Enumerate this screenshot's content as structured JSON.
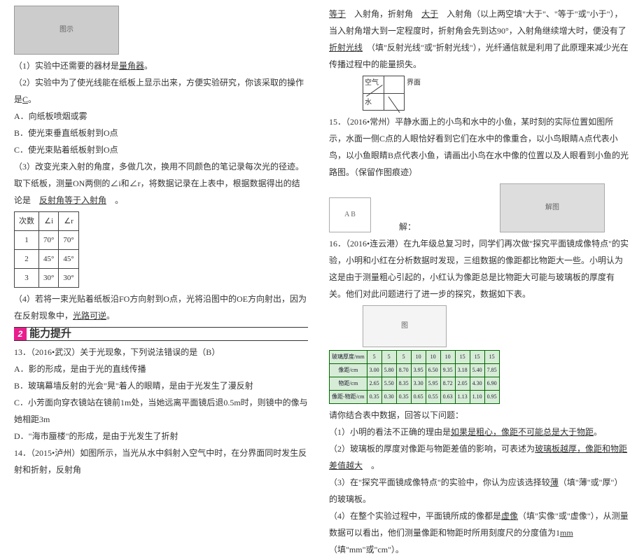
{
  "left": {
    "fig_label": "图示",
    "q1": "（1）实验中还需要的器材是",
    "a1": "量角器",
    "period": "。",
    "q2": "（2）实验中为了使光线能在纸板上显示出来，方便实验研究，你该采取的操作是",
    "a2": "C",
    "optA": "A．向纸板喷烟或雾",
    "optB": "B．使光束垂直纸板射到O点",
    "optC": "C．使光束贴着纸板射到O点",
    "q3a": "（3）改变光束入射的角度，多做几次，换用不同颜色的笔记录每次光的径迹。取下纸板，测量ON两侧的∠i和∠r，将数据记录在上表中，根据数据得出的结论是",
    "a3": "反射角等于入射角",
    "t1": {
      "h_n": "次数",
      "h_i": "∠i",
      "h_r": "∠r",
      "r1": [
        "1",
        "70°",
        "70°"
      ],
      "r2": [
        "2",
        "45°",
        "45°"
      ],
      "r3": [
        "3",
        "30°",
        "30°"
      ]
    },
    "q4a": "（4）若将一束光贴着纸板沿FO方向射到O点，光将沿图中的OE方向射出，因为在反射现象中，",
    "a4": "光路可逆",
    "ability_num": "2",
    "ability_text": "能力提升",
    "q13": "13．（2016•武汉）关于光现象，下列说法错误的是（B）",
    "q13A": "A．影的形成，是由于光的直线传播",
    "q13B": "B．玻璃幕墙反射的光会\"晃\"着人的眼睛，是由于光发生了漫反射",
    "q13C": "C．小芳面向穿衣镜站在镜前1m处，当她远离平面镜后退0.5m时，则镜中的像与她相距3m",
    "q13D": "D．\"海市蜃楼\"的形成，是由于光发生了折射",
    "q14a": "14．（2015•泸州）如图所示，当光从水中斜射入空气中时，在分界面同时发生反射和折射，反射角"
  },
  "right": {
    "q14b1": "入射角，折射角",
    "a14a": "等于",
    "a14b": "大于",
    "q14b2": "入射角（以上两空填\"大于\"、\"等于\"或\"小于\"），当入射角增大到一定程度时，折射角会先到达90°，入射角继续增大时，便没有了",
    "a14c": "折射光线",
    "q14b3": "（填\"反射光线\"或\"折射光线\"），光纤通信就是利用了此原理来减少光在传播过程中的能量损失。",
    "air_top": "空气",
    "air_right": "界面",
    "air_bottom": "水",
    "q15": "15．（2016•常州）平静水面上的小鸟和水中的小鱼，某时刻的实际位置如图所示，水面一侧C点的人眼恰好看到它们在水中的像重合，以小鸟眼睛A点代表小鸟，以小鱼眼睛B点代表小鱼，请画出小鸟在水中像的位置以及人眼看到小鱼的光路图。（保留作图痕迹）",
    "sol": "解：",
    "q16a": "16．（2016•连云港）在九年级总复习时，同学们再次做\"探究平面镜成像特点\"的实验，小明和小红在分析数据时发现，三组数据的像距都比物距大一些。小明认为这是由于测量粗心引起的，小红认为像距总是比物距大可能与玻璃板的厚度有关。他们对此问题进行了进一步的探究，数据如下表。",
    "t2": {
      "h": [
        "玻璃厚度/mm",
        "5",
        "5",
        "5",
        "10",
        "10",
        "10",
        "15",
        "15",
        "15"
      ],
      "r1": [
        "像距/cm",
        "3.00",
        "5.80",
        "8.70",
        "3.95",
        "6.50",
        "9.35",
        "3.18",
        "5.40",
        "7.85"
      ],
      "r2": [
        "物距/cm",
        "2.65",
        "5.50",
        "8.35",
        "3.30",
        "5.95",
        "8.72",
        "2.05",
        "4.30",
        "6.90"
      ],
      "r3": [
        "像距-物距/cm",
        "0.35",
        "0.30",
        "0.35",
        "0.65",
        "0.55",
        "0.63",
        "1.13",
        "1.10",
        "0.95"
      ]
    },
    "q16b": "请你结合表中数据，回答以下问题：",
    "q16_1": "（1）小明的看法不正确的理由是",
    "a16_1": "如果是粗心，像距不可能总是大于物距",
    "q16_2a": "（2）玻璃板的厚度对像距与物距差值的影响，可表述为",
    "a16_2": "玻璃板越厚，像距和物距差值越大",
    "q16_3a": "（3）在\"探究平面镜成像特点\"的实验中，你认为应该选择较",
    "a16_3": "薄",
    "q16_3b": "（填\"薄\"或\"厚\"）的玻璃板。",
    "q16_4a": "（4）在整个实验过程中，平面镜所成的像都是",
    "a16_4a": "虚像",
    "q16_4b": "（填\"实像\"或\"虚像\"），从测量数据可以看出，他们测量像距和物距时所用刻度尺的分度值为1",
    "a16_4c": "mm",
    "q16_4c": "（填\"mm\"或\"cm\"）。"
  }
}
